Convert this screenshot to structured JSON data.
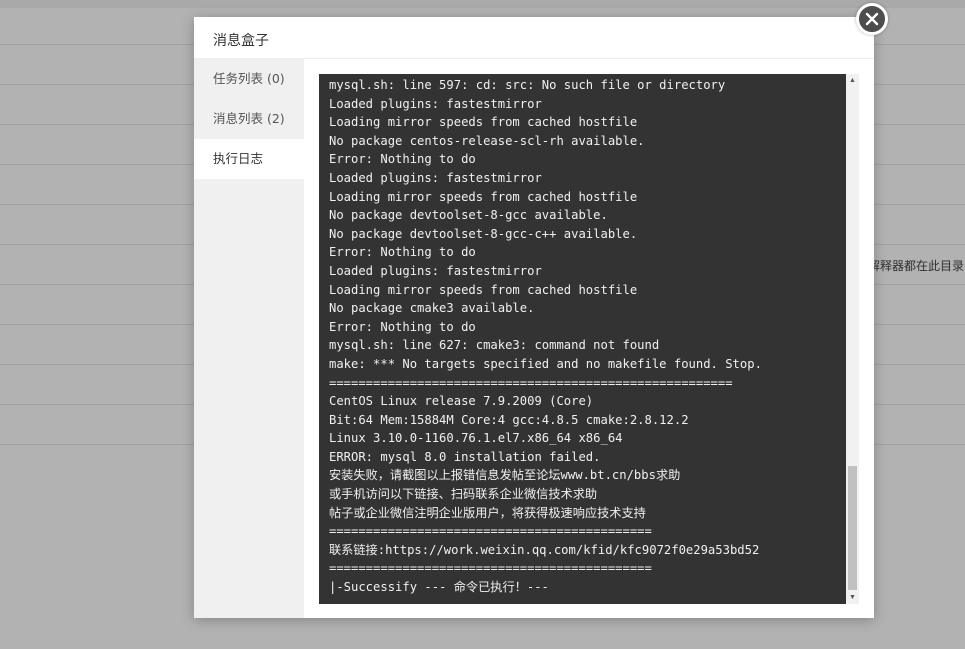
{
  "background": {
    "side_text": "解释器都在此目录"
  },
  "modal": {
    "title": "消息盒子",
    "sidebar": {
      "items": [
        {
          "label": "任务列表 (0)"
        },
        {
          "label": "消息列表 (2)"
        },
        {
          "label": "执行日志"
        }
      ],
      "active_index": 2
    },
    "log_lines": [
      "mysql.sh: line 597: cd: src: No such file or directory",
      "Loaded plugins: fastestmirror",
      "Loading mirror speeds from cached hostfile",
      "No package centos-release-scl-rh available.",
      "Error: Nothing to do",
      "Loaded plugins: fastestmirror",
      "Loading mirror speeds from cached hostfile",
      "No package devtoolset-8-gcc available.",
      "No package devtoolset-8-gcc-c++ available.",
      "Error: Nothing to do",
      "Loaded plugins: fastestmirror",
      "Loading mirror speeds from cached hostfile",
      "No package cmake3 available.",
      "Error: Nothing to do",
      "mysql.sh: line 627: cmake3: command not found",
      "make: *** No targets specified and no makefile found. Stop.",
      "=======================================================",
      "CentOS Linux release 7.9.2009 (Core)",
      "Bit:64 Mem:15884M Core:4 gcc:4.8.5 cmake:2.8.12.2",
      "Linux 3.10.0-1160.76.1.el7.x86_64 x86_64",
      "ERROR: mysql 8.0 installation failed.",
      "安装失败，请截图以上报错信息发帖至论坛www.bt.cn/bbs求助",
      "或手机访问以下链接、扫码联系企业微信技术求助",
      "帖子或企业微信注明企业版用户，将获得极速响应技术支持",
      "============================================",
      "联系链接:https://work.weixin.qq.com/kfid/kfc9072f0e29a53bd52",
      "============================================",
      "|-Successify --- 命令已执行！---"
    ]
  },
  "colors": {
    "terminal_bg": "#333333",
    "terminal_text": "#f0f0f0",
    "close_button": "#4d4d4d",
    "sidebar_bg": "#f0f0f0"
  },
  "icons": {
    "close": "close-icon",
    "scroll_up": "scroll-up-arrow-icon",
    "scroll_down": "scroll-down-arrow-icon"
  }
}
